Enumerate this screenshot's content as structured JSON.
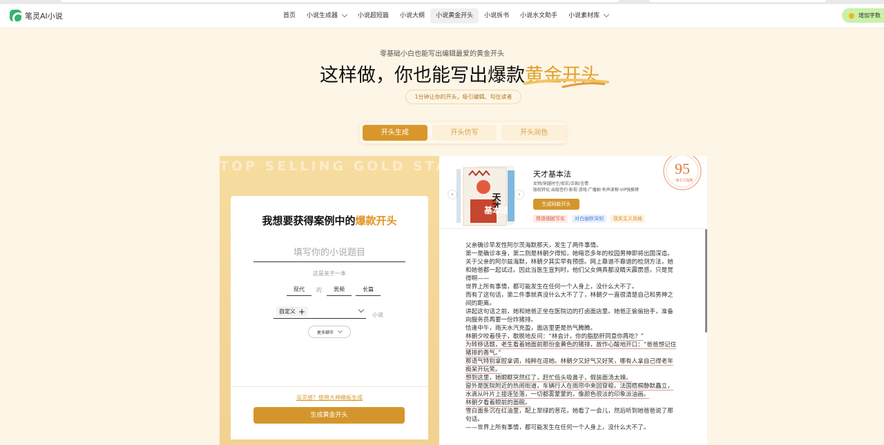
{
  "nav": {
    "logo_text": "笔灵AI小说",
    "items": [
      {
        "label": "首页",
        "has_dropdown": false,
        "active": false
      },
      {
        "label": "小说生成器",
        "has_dropdown": true,
        "active": false
      },
      {
        "label": "小说超短篇",
        "has_dropdown": false,
        "active": false
      },
      {
        "label": "小说大纲",
        "has_dropdown": false,
        "active": false
      },
      {
        "label": "小说黄金开头",
        "has_dropdown": false,
        "active": true
      },
      {
        "label": "小说拆书",
        "has_dropdown": false,
        "active": false
      },
      {
        "label": "小说水文助手",
        "has_dropdown": false,
        "active": false
      },
      {
        "label": "小说素材库",
        "has_dropdown": true,
        "active": false
      }
    ],
    "bonus_label": "增加字数"
  },
  "hero": {
    "subtitle": "零基础小白也能写出编辑最爱的黄金开头",
    "title_main": "这样做，你也能写出爆款",
    "title_highlight": "黄金开头",
    "badge": "1分钟让你的开头，吸引编辑、勾住读者"
  },
  "tabs": [
    {
      "label": "开头生成",
      "active": true
    },
    {
      "label": "开头仿写",
      "active": false
    },
    {
      "label": "开头润色",
      "active": false
    }
  ],
  "left_panel": {
    "bg_words": "TOP SELLING GOLD START",
    "form_title_main": "我想要获得案例中的",
    "form_title_highlight": "爆款开头",
    "title_placeholder": "填写你的小说题目",
    "about_label": "这是关于一本",
    "era": "现代",
    "connector": "的",
    "channel": "男频",
    "length": "长篇",
    "custom_label": "自定义",
    "genre_suffix": "小说",
    "more_details": "更多细节",
    "template_link": "没灵感？使用大神模板生成",
    "generate_button": "生成黄金开头"
  },
  "example": {
    "book_title": "天才基本法",
    "tags_line1": "女频/穿越时空/现实/正剧/言情",
    "tags_line2": "版权转化:出版签约·影视·游戏·广播剧·有声读物·VIP强推榜",
    "same_button": "生成同款开头",
    "feature_tags": [
      {
        "label": "情感细腻写实",
        "color": "#e0553a",
        "bg": "#fdecea"
      },
      {
        "label": "对白幽默深刻",
        "color": "#4a7fd6",
        "bg": "#eaf1fd"
      },
      {
        "label": "现实主义风格",
        "color": "#d5902a",
        "bg": "#fdf3e2"
      }
    ],
    "score": "95",
    "score_label": "吸引力指数",
    "cover_text": "天才基本法",
    "paragraphs": [
      "父亲确诊早发性阿尔茨海默那天，发生了两件事情。",
      "第一是确诊本身，第二则是林朝夕得知，她暗恋多年的校园男神即将出国深造。",
      "关于父亲的阿尔兹海默，林朝夕其实早有预感。网上靠谱不靠谱的检测方法，她和她爸都一起试过。因此当医生宣判时，他们父女俩真都没睛天霹雳感，只是觉得啊——",
      "世界上所有事情，都可能发生在任何一个人身上，没什么大不了。",
      "而有了这句话，第二件事就真没什么大不了了，林朝夕一直很清楚自己和男神之间的距离。",
      "讲起这句话之前，她和她爸正坐在医院边的打卤面店里。她爸正偷偷抬手，准备向服务员再要一份炸猪排。",
      "恰逢中午，雨天水汽充盈，面店里更是热气腾腾。",
      "林朝夕咬着筷子，歇脱地反问：“林会计，你的脂肪肝同意你再吃？”",
      "为转移话题，老生看着她面前那份金黄色的猪排，故作心酸地开口：“爸爸想记住猪排的香气。”",
      "那语气特别拿腔拿调，纯粹在逗她。林朝夕又好气又好笑，哪有人拿自己得老年痴呆开玩笑。",
      "想到这里，她眼眶突然红了，赶忙低头吸鼻子，假装面汤太辣。",
      "窗外是医院附近的热闹街道，车辆行人在雨帘中来回穿梭。法国梧桐静默矗立，水滴从叶片上接连坠落，一切都雾蒙蒙的，像颜色很淡的印象派油画。",
      "林朝夕看着眼前的面碗。",
      "雪白面条沉在红油里，配上翠绿的葱花，她看了一会儿，然后听到她爸爸说了那句话。",
      "——世界上所有事情，都可能发生在任何一个人身上，没什么大不了。"
    ],
    "underlined_from": 7,
    "underlined_to": 12
  },
  "colors": {
    "accent": "#d4962c",
    "hero_gold": "#e0a12a",
    "panel_bg": "#f5d89b",
    "page_bg": "#fdf5e6"
  }
}
